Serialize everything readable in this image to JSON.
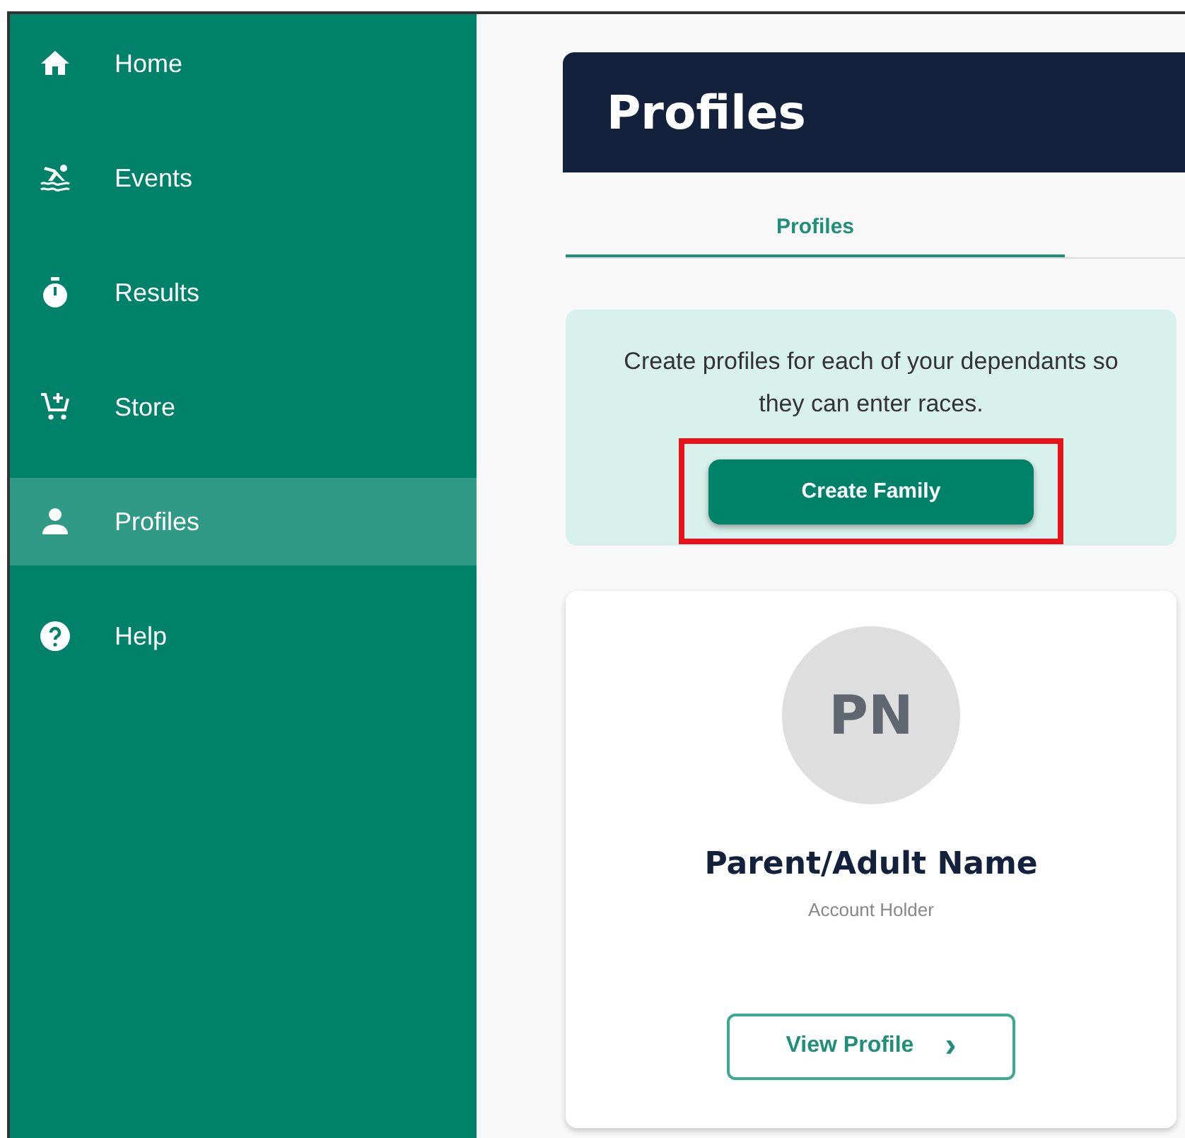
{
  "sidebar": {
    "items": [
      {
        "label": "Home",
        "selected": false
      },
      {
        "label": "Events",
        "selected": false
      },
      {
        "label": "Results",
        "selected": false
      },
      {
        "label": "Store",
        "selected": false
      },
      {
        "label": "Profiles",
        "selected": true
      },
      {
        "label": "Help",
        "selected": false
      }
    ]
  },
  "header": {
    "title": "Profiles"
  },
  "tabs": [
    {
      "label": "Profiles",
      "selected": true
    }
  ],
  "info": {
    "text": "Create profiles for each of your dependants so they can enter races.",
    "button": {
      "label": "Create Family",
      "highlighted": true
    }
  },
  "profile_card": {
    "initials": "PN",
    "name": "Parent/Adult Name",
    "role": "Account Holder",
    "button": {
      "label": "View Profile",
      "chevron": "›"
    }
  }
}
